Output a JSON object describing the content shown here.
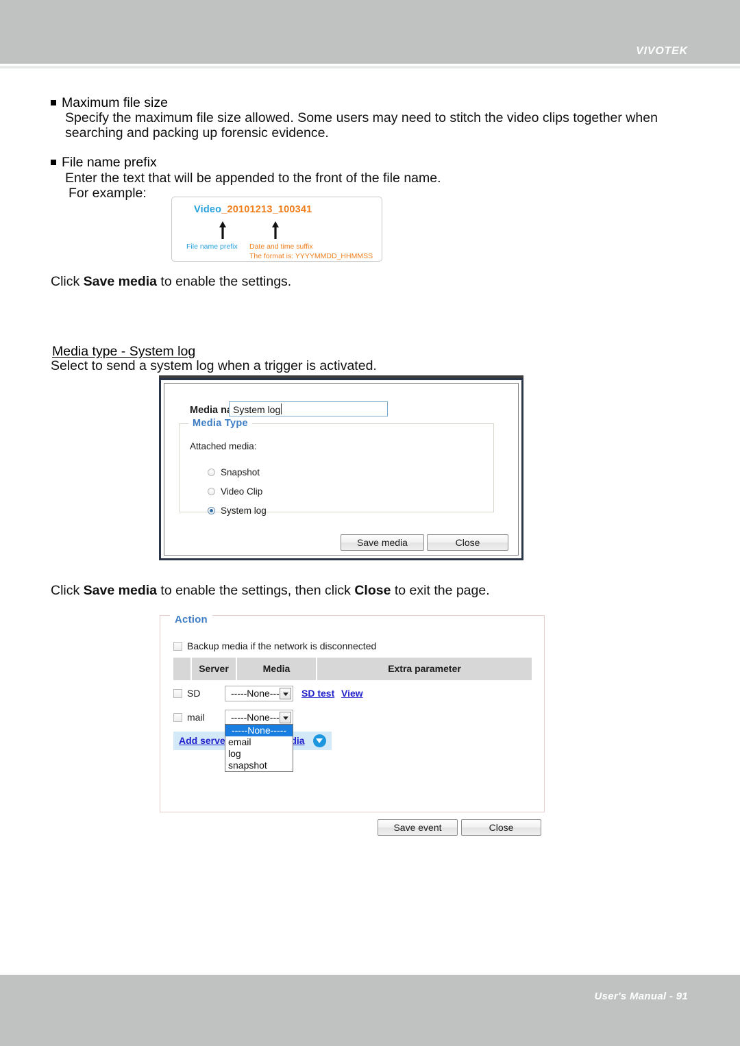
{
  "page": {
    "brand": "VIVOTEK",
    "footer": "User's Manual - 91",
    "colors": {
      "header_gray": "#c0c2c1",
      "accent_blue": "#3d7dc4",
      "example_blue": "#2aa3dd",
      "example_orange": "#f07d1a",
      "link_blue": "#2222cc",
      "select_highlight": "#1a7ee0"
    }
  },
  "body": {
    "bullets": [
      {
        "title": "Maximum file size",
        "lines": [
          "Specify the maximum file size allowed. Some users may need to stitch the video clips together when",
          "searching and packing up forensic evidence."
        ]
      },
      {
        "title": "File name prefix",
        "lines": [
          "Enter the text that will be appended to the front of the file name.",
          "For example:"
        ]
      }
    ],
    "click_save_media_1": {
      "pre": "Click ",
      "bold1": "Save media",
      "post": " to enable the settings."
    },
    "section_heading": "Media type - System log",
    "section_text": "Select to send a system log when a trigger is activated.",
    "click_save_media_2": {
      "pre": "Click ",
      "bold1": "Save media",
      "mid": " to enable the settings, then click ",
      "bold2": "Close",
      "post": " to exit the page."
    }
  },
  "example_figure": {
    "filename_prefix": "Video",
    "filename_separator": "_",
    "filename_suffix": "20101213_100341",
    "label_prefix": "File name prefix",
    "label_suffix": "Date and time suffix",
    "label_format": "The format is: YYYYMMDD_HHMMSS"
  },
  "media_dialog": {
    "media_name_label": "Media name:",
    "media_name_value": "System log",
    "fieldset_legend": "Media Type",
    "attached_media_label": "Attached media:",
    "radio_options": [
      {
        "label": "Snapshot",
        "selected": false
      },
      {
        "label": "Video Clip",
        "selected": false
      },
      {
        "label": "System log",
        "selected": true
      }
    ],
    "save_button": "Save media",
    "close_button": "Close"
  },
  "action_panel": {
    "legend": "Action",
    "backup_checkbox_label": "Backup media if the network is disconnected",
    "table_headers": [
      "",
      "Server",
      "Media",
      "Extra parameter"
    ],
    "rows": [
      {
        "server": "SD",
        "media_value": "-----None-----",
        "extra_links": [
          "SD test",
          "View"
        ]
      },
      {
        "server": "mail",
        "media_value": "-----None-----",
        "extra_links": []
      }
    ],
    "dropdown_open": {
      "options": [
        "-----None-----",
        "email",
        "log",
        "snapshot"
      ],
      "selected_index": 0
    },
    "add_server_link": "Add server",
    "add_media_link": "Add media",
    "save_button": "Save event",
    "close_button": "Close"
  }
}
